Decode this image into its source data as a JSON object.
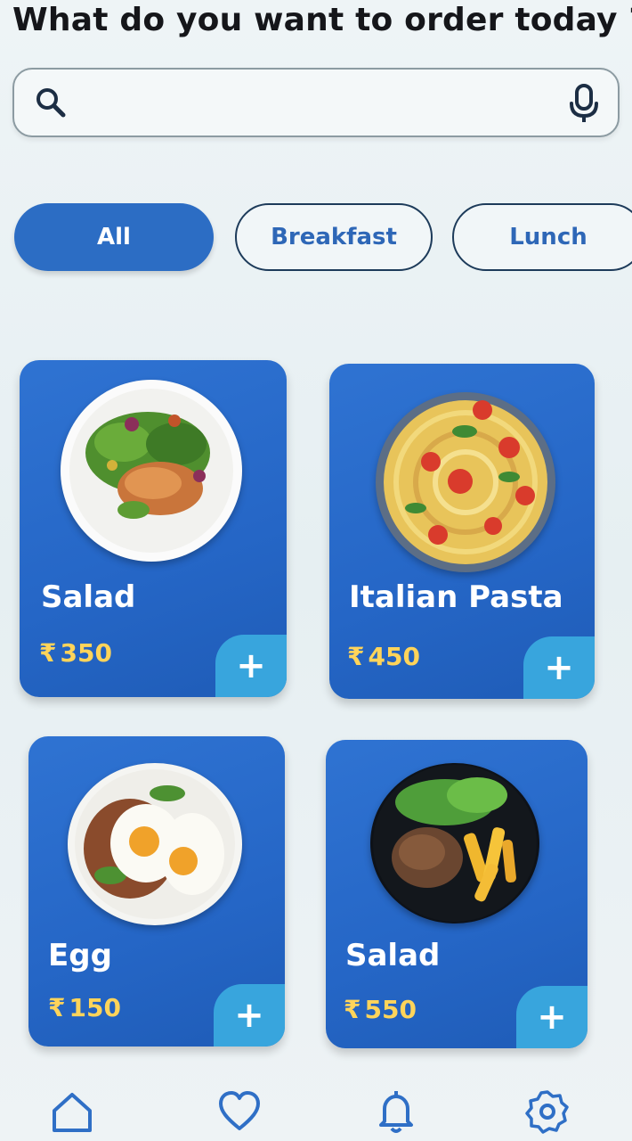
{
  "header": {
    "title": "What do you want to order today ?"
  },
  "search": {
    "placeholder": "",
    "value": "",
    "search_icon": "search-icon",
    "mic_icon": "microphone-icon"
  },
  "categories": [
    {
      "label": "All",
      "active": true
    },
    {
      "label": "Breakfast",
      "active": false
    },
    {
      "label": "Lunch",
      "active": false
    }
  ],
  "currency_symbol": "₹",
  "foods": [
    {
      "name": "Salad",
      "price": "350",
      "add_label": "+"
    },
    {
      "name": "Italian Pasta",
      "price": "450",
      "add_label": "+"
    },
    {
      "name": "Egg",
      "price": "150",
      "add_label": "+"
    },
    {
      "name": "Salad",
      "price": "550",
      "add_label": "+"
    }
  ],
  "bottom_nav": {
    "items": [
      "home-icon",
      "heart-icon",
      "bell-icon",
      "settings-icon"
    ],
    "active": "home-icon"
  },
  "colors": {
    "primary": "#2c6dc4",
    "card": "#2566c6",
    "price": "#ffd45a",
    "add_button": "#38a5dd",
    "nav_icon": "#2f6fc6"
  }
}
